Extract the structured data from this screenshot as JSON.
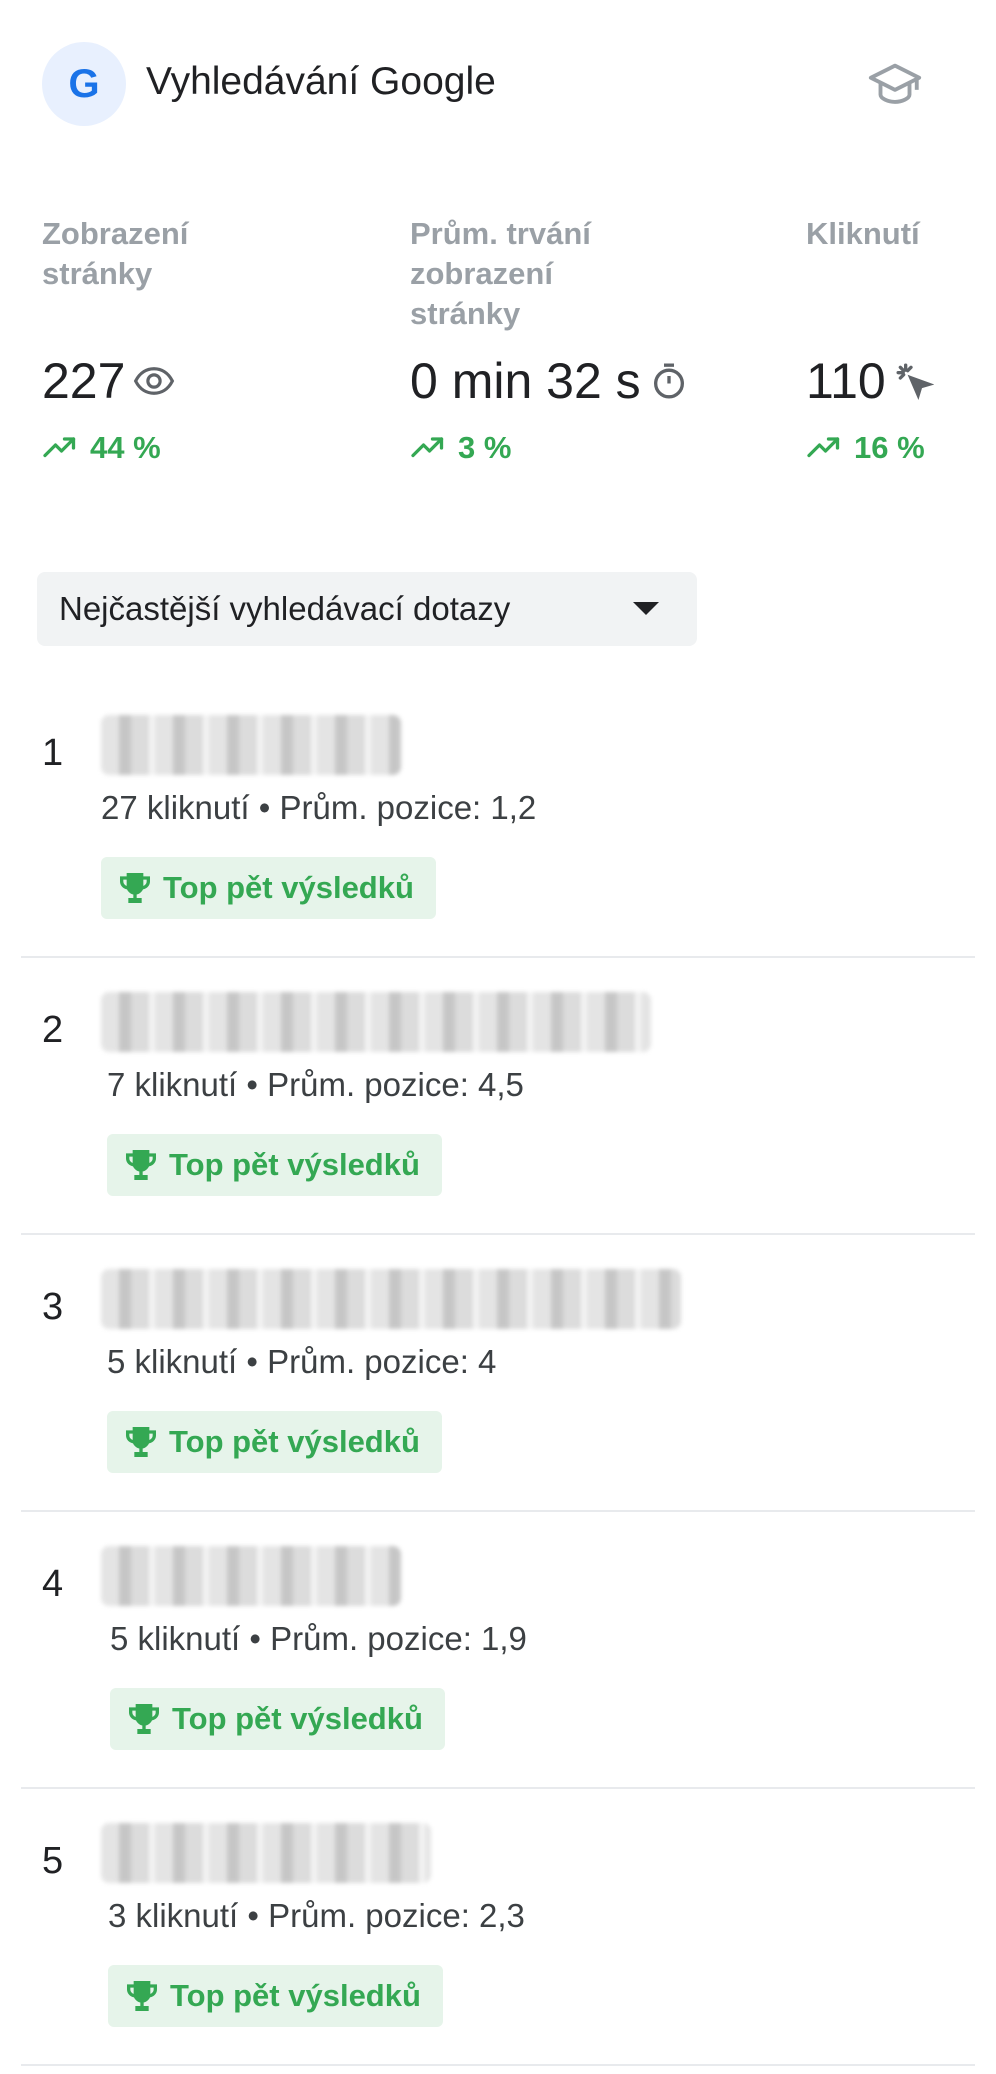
{
  "header": {
    "logo_letter": "G",
    "title": "Vyhledávání Google",
    "cap_icon": "school-icon"
  },
  "metrics": [
    {
      "label": "Zobrazení stránky",
      "value": "227",
      "icon": "eye-icon",
      "change": "44 %"
    },
    {
      "label": "Prům. trvání zobrazení stránky",
      "value": "0 min 32 s",
      "icon": "timer-icon",
      "change": "3 %"
    },
    {
      "label": "Kliknutí",
      "value": "110",
      "icon": "click-icon",
      "change": "16 %"
    }
  ],
  "dropdown": {
    "label": "Nejčastější vyhledávací dotazy"
  },
  "queries": [
    {
      "rank": "1",
      "stats": "27 kliknutí • Prům. pozice: 1,2",
      "badge": "Top pět výsledků"
    },
    {
      "rank": "2",
      "stats": "7 kliknutí • Prům. pozice: 4,5",
      "badge": "Top pět výsledků"
    },
    {
      "rank": "3",
      "stats": "5 kliknutí • Prům. pozice: 4",
      "badge": "Top pět výsledků"
    },
    {
      "rank": "4",
      "stats": "5 kliknutí • Prům. pozice: 1,9",
      "badge": "Top pět výsledků"
    },
    {
      "rank": "5",
      "stats": "3 kliknutí • Prům. pozice: 2,3",
      "badge": "Top pět výsledků"
    }
  ],
  "colors": {
    "accent_blue": "#1a73e8",
    "positive_green": "#34a853",
    "badge_bg": "#e6f4ea",
    "muted_text": "#9aa0a6"
  }
}
